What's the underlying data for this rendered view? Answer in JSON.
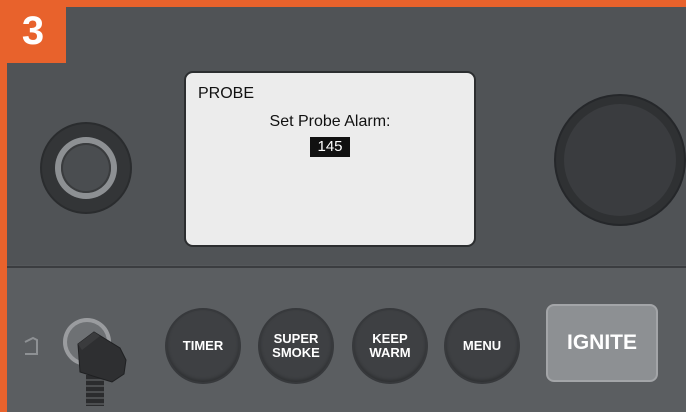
{
  "step_badge": "3",
  "display": {
    "mode": "PROBE",
    "prompt": "Set Probe Alarm:",
    "value": "145"
  },
  "buttons": {
    "timer": "TIMER",
    "super_smoke": [
      "SUPER",
      "SMOKE"
    ],
    "keep_warm": [
      "KEEP",
      "WARM"
    ],
    "menu": "MENU",
    "ignite": "IGNITE"
  },
  "icons": {
    "power": "power-button",
    "dial": "control-dial",
    "probe": "probe-icon",
    "connector": "probe-connector"
  },
  "colors": {
    "frame": "#e8622c",
    "panel": "#55585b",
    "lcd": "#ececec",
    "ignite": "#8d9093"
  }
}
